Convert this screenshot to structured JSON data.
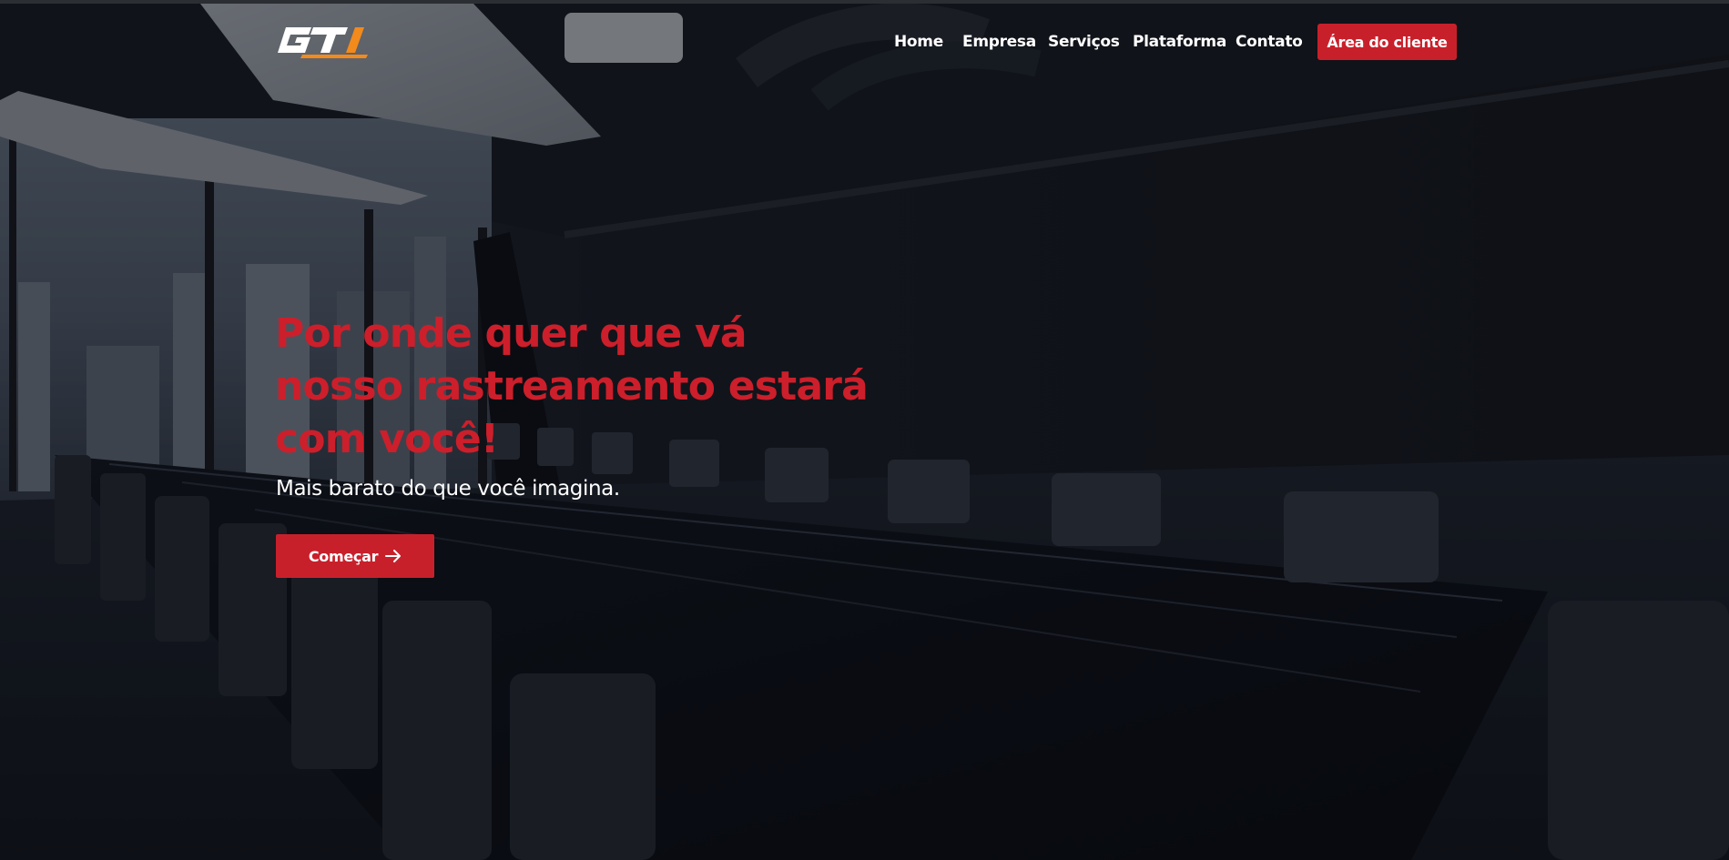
{
  "brand": {
    "logo_text": "GTI",
    "logo_colors": {
      "main": "#ffffff",
      "accent": "#f28a1c"
    }
  },
  "nav": {
    "items": [
      {
        "label": "Home"
      },
      {
        "label": "Empresa"
      },
      {
        "label": "Serviços"
      },
      {
        "label": "Plataforma"
      },
      {
        "label": "Contato"
      }
    ],
    "client_button": "Área do cliente"
  },
  "hero": {
    "title": "Por onde quer que vá nosso rastreamento estará com você!",
    "subtitle": "Mais barato do que você imagina.",
    "cta_label": "Começar",
    "cta_icon": "arrow-right-icon"
  },
  "colors": {
    "accent": "#c8202b",
    "title": "#cc1f2b",
    "text": "#ffffff"
  }
}
